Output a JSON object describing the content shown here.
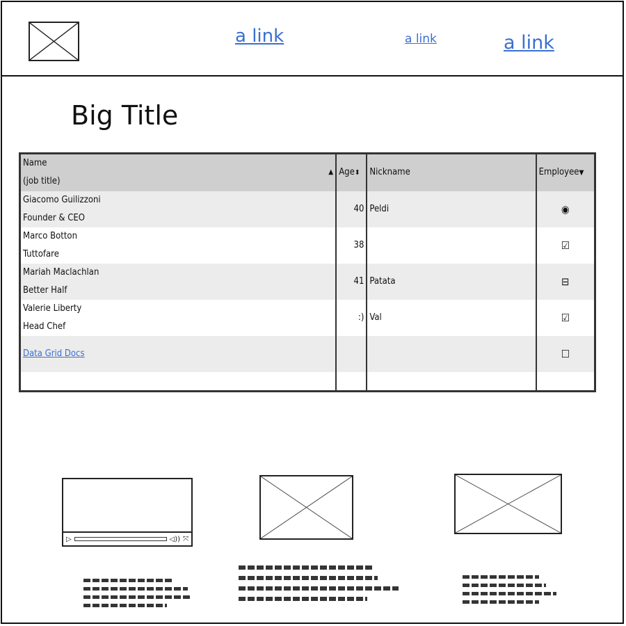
{
  "header": {
    "links": [
      "a link",
      "a link",
      "a link"
    ]
  },
  "page_title": "Big Title",
  "grid": {
    "columns": [
      {
        "label_line1": "Name",
        "label_line2": "(job title)",
        "sort": "▲"
      },
      {
        "label": "Age",
        "sort": "⬍"
      },
      {
        "label": "Nickname"
      },
      {
        "label": "Employee",
        "sort": "▼"
      }
    ],
    "rows": [
      {
        "name": "Giacomo Guilizzoni",
        "title": "Founder & CEO",
        "age": "40",
        "nickname": "Peldi",
        "employee": "◉"
      },
      {
        "name": "Marco Botton",
        "title": "Tuttofare",
        "age": "38",
        "nickname": "",
        "employee": "☑"
      },
      {
        "name": "Mariah Maclachlan",
        "title": "Better Half",
        "age": "41",
        "nickname": "Patata",
        "employee": "⊟"
      },
      {
        "name": "Valerie Liberty",
        "title": "Head Chef",
        "age": ":)",
        "nickname": "Val",
        "employee": "☑"
      }
    ],
    "footer_link": "Data Grid Docs",
    "footer_employee": "☐"
  },
  "icons": {
    "play": "▷",
    "volume": "◁))",
    "fullscreen": "⤧"
  }
}
